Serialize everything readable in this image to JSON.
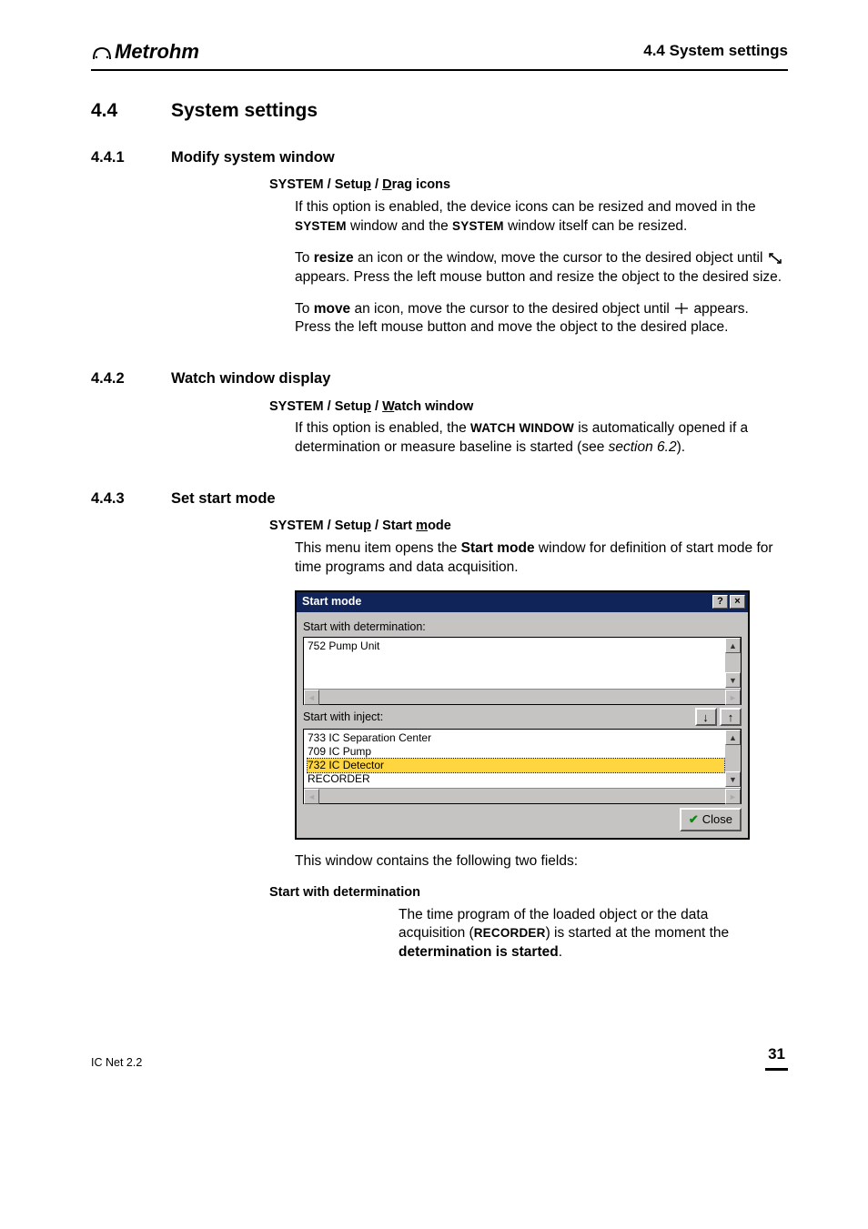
{
  "brand": "Metrohm",
  "header_right": "4.4  System settings",
  "sec": {
    "num": "4.4",
    "title": "System settings"
  },
  "s441": {
    "num": "4.4.1",
    "title": "Modify system window",
    "menu_a": "SYSTEM / Setu",
    "menu_p": "p",
    "menu_b": " / ",
    "menu_d": "D",
    "menu_c": "rag icons",
    "p1a": "If this option is enabled, the device icons can be resized and moved in the ",
    "p1b": "SYSTEM",
    "p1c": " window and the ",
    "p1d": "SYSTEM",
    "p1e": " window itself can be resized.",
    "p2a": "To ",
    "p2b": "resize",
    "p2c": " an icon or the window, move the cursor to the desired object until ",
    "p2d": " appears. Press the left mouse button and resize the object to the desired size.",
    "p3a": "To ",
    "p3b": "move",
    "p3c": " an icon, move the cursor to the desired object until ",
    "p3d": " appears. Press the left mouse button and move the object to the desired place."
  },
  "s442": {
    "num": "4.4.2",
    "title": "Watch window display",
    "menu_a": "SYSTEM / Setu",
    "menu_p": "p",
    "menu_b": " / ",
    "menu_w": "W",
    "menu_c": "atch window",
    "p1a": "If this option is enabled, the ",
    "p1b": "WATCH WINDOW",
    "p1c": " is automatically opened if a determination or measure baseline is started (see ",
    "p1d": "section 6.2",
    "p1e": ")."
  },
  "s443": {
    "num": "4.4.3",
    "title": "Set start mode",
    "menu_a": "SYSTEM / Setu",
    "menu_p": "p",
    "menu_b": " / Start ",
    "menu_m": "m",
    "menu_c": "ode",
    "p1a": "This menu item opens the ",
    "p1b": "Start mode",
    "p1c": " window for definition of start mode for time programs and data acquisition.",
    "after": "This window contains the following two fields:",
    "fieldhead": "Start with determination",
    "f_a": "The time program of the loaded object or the data acquisition (",
    "f_b": "RECORDER",
    "f_c": ") is started at the moment the ",
    "f_d": "determination is started",
    "f_e": "."
  },
  "dlg": {
    "title": "Start mode",
    "label1": "Start with determination:",
    "list1": [
      "752 Pump Unit"
    ],
    "label2": "Start with inject:",
    "list2": [
      "733 IC Separation Center",
      "709 IC Pump",
      "732 IC Detector",
      "RECORDER"
    ],
    "list2_sel_index": 2,
    "close": "Close"
  },
  "footer": {
    "left": "IC Net 2.2",
    "page": "31"
  }
}
